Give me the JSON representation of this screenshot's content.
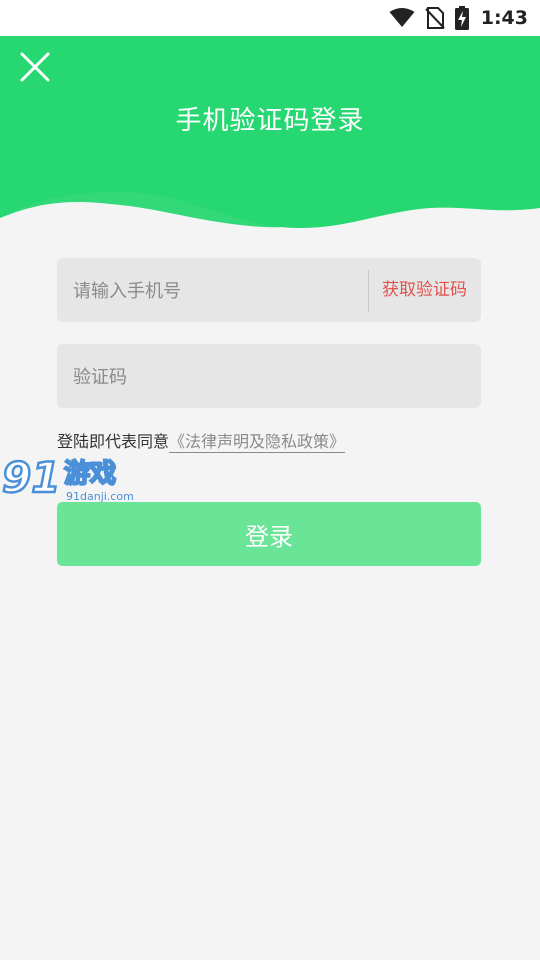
{
  "status_bar": {
    "time": "1:43",
    "icons": [
      "wifi-icon",
      "no-sim-icon",
      "battery-charging-icon"
    ]
  },
  "header": {
    "title": "手机验证码登录",
    "close_icon": "close-icon",
    "color": "#27d872"
  },
  "form": {
    "phone_placeholder": "请输入手机号",
    "get_code_label": "获取验证码",
    "code_placeholder": "验证码",
    "agreement_prefix": "登陆即代表同意",
    "agreement_link": "《法律声明及隐私政策》",
    "login_label": "登录"
  },
  "watermark": {
    "brand": "游戏",
    "number": "91",
    "domain": "91danji.com"
  },
  "colors": {
    "accent": "#27d872",
    "button": "#6ae497",
    "link_red": "#e0524e",
    "background": "#f4f4f4"
  }
}
